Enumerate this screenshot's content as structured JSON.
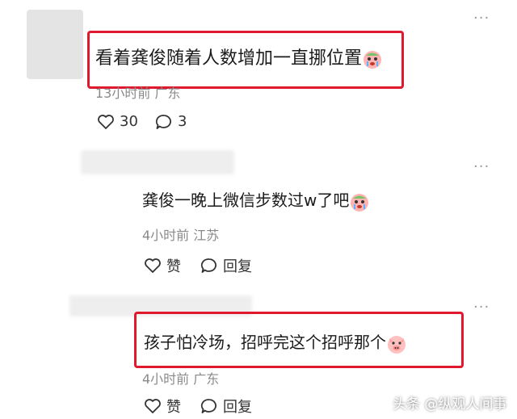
{
  "comments": [
    {
      "text": "看着龚俊随着人数增加一直挪位置",
      "meta": "13小时前 广东",
      "like_count": "30",
      "reply_count": "3",
      "emoji": "crying-face-emoji"
    }
  ],
  "replies": [
    {
      "text": "龚俊一晚上微信步数过w了吧",
      "meta": "4小时前 江苏",
      "like_label": "赞",
      "reply_label": "回复",
      "emoji": "crying-face-emoji"
    },
    {
      "text": "孩子怕冷场，招呼完这个招呼那个",
      "meta": "4小时前 广东",
      "like_label": "赞",
      "reply_label": "回复",
      "emoji": "pig-face-emoji"
    }
  ],
  "more_glyph": "···",
  "watermark": "头条 @纵观人间事",
  "colors": {
    "highlight_border": "#e0192f",
    "meta_text": "#8a8a8a"
  }
}
